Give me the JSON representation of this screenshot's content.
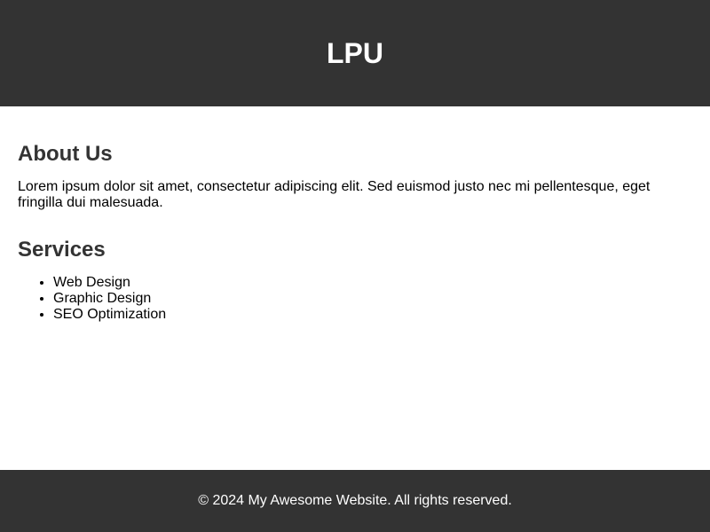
{
  "header": {
    "title": "LPU"
  },
  "about": {
    "heading": "About Us",
    "text": "Lorem ipsum dolor sit amet, consectetur adipiscing elit. Sed euismod justo nec mi pellentesque, eget fringilla dui malesuada."
  },
  "services": {
    "heading": "Services",
    "items": [
      "Web Design",
      "Graphic Design",
      "SEO Optimization"
    ]
  },
  "footer": {
    "text": "© 2024 My Awesome Website. All rights reserved."
  },
  "colors": {
    "header_bg": "#333333",
    "footer_bg": "#333333",
    "heading_text": "#333333"
  }
}
